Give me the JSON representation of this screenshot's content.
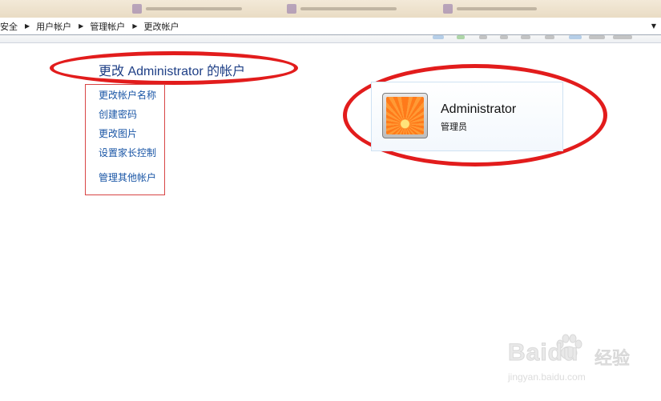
{
  "breadcrumb": {
    "items": [
      "安全",
      "用户帐户",
      "管理帐户",
      "更改帐户"
    ]
  },
  "page": {
    "title": "更改 Administrator 的帐户"
  },
  "tasks": {
    "items": [
      "更改帐户名称",
      "创建密码",
      "更改图片",
      "设置家长控制",
      "管理其他帐户"
    ]
  },
  "user": {
    "name": "Administrator",
    "role": "管理员"
  },
  "watermark": {
    "brand": "Baidu",
    "cn": "经验",
    "url": "jingyan.baidu.com"
  },
  "colors": {
    "link": "#1a56a6",
    "title": "#1e3f86",
    "annotation": "#e21c1c"
  }
}
